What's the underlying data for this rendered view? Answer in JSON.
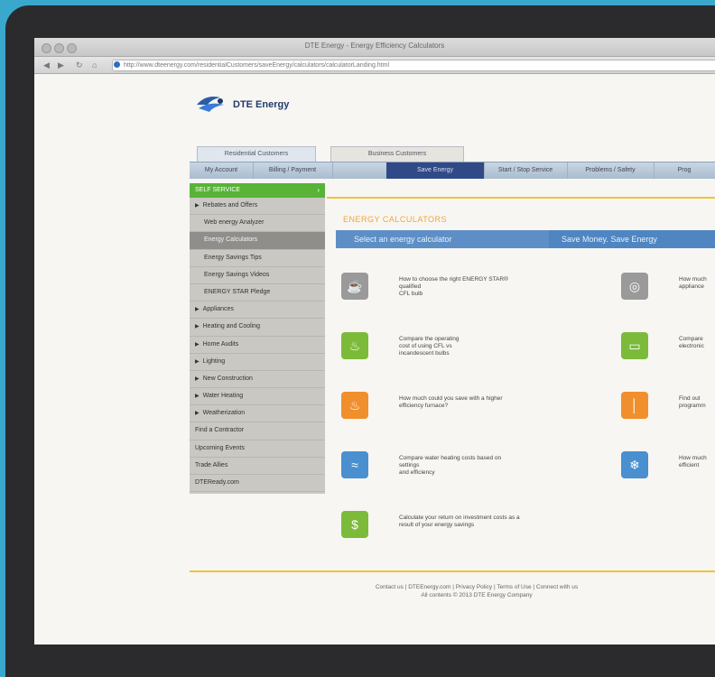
{
  "window": {
    "title": "DTE Energy - Energy Efficiency Calculators",
    "url": "http://www.dteenergy.com/residentialCustomers/saveEnergy/calculators/calculatorLanding.html"
  },
  "brand": {
    "name": "DTE Energy"
  },
  "customer_tabs": [
    "Residential Customers",
    "Business Customers"
  ],
  "nav": {
    "tabs": [
      "My Account",
      "Billing / Payment",
      "Save Energy",
      "Start / Stop Service",
      "Problems / Safety",
      "Prog"
    ],
    "active": "Save Energy"
  },
  "sidebar": {
    "header": "SELF SERVICE",
    "items": [
      {
        "label": "Rebates and Offers",
        "bullet": true,
        "sub": false
      },
      {
        "label": "Web energy Analyzer",
        "bullet": false,
        "sub": true
      },
      {
        "label": "Energy Calculators",
        "bullet": false,
        "sub": true,
        "selected": true
      },
      {
        "label": "Energy Savings Tips",
        "bullet": false,
        "sub": true
      },
      {
        "label": "Energy Savings Videos",
        "bullet": false,
        "sub": true
      },
      {
        "label": "ENERGY STAR Pledge",
        "bullet": false,
        "sub": true
      },
      {
        "label": "Appliances",
        "bullet": true,
        "sub": false
      },
      {
        "label": "Heating and Cooling",
        "bullet": true,
        "sub": false
      },
      {
        "label": "Home Audits",
        "bullet": true,
        "sub": false
      },
      {
        "label": "Lighting",
        "bullet": true,
        "sub": false
      },
      {
        "label": "New Construction",
        "bullet": true,
        "sub": false
      },
      {
        "label": "Water Heating",
        "bullet": true,
        "sub": false
      },
      {
        "label": "Weatherization",
        "bullet": true,
        "sub": false
      },
      {
        "label": "Find a Contractor",
        "bullet": false,
        "sub": false
      },
      {
        "label": "Upcoming Events",
        "bullet": false,
        "sub": false
      },
      {
        "label": "Trade Allies",
        "bullet": false,
        "sub": false
      },
      {
        "label": "DTEReady.com",
        "bullet": false,
        "sub": false
      }
    ]
  },
  "main": {
    "section_title": "ENERGY CALCULATORS",
    "banner_left": "Select an energy calculator",
    "banner_right": "Save Money. Save Energy",
    "calculators_left": [
      {
        "icon": "lamp-icon",
        "color": "#9a9a9a",
        "glyph": "☕",
        "text": [
          "How to choose the right ENERGY STAR®",
          "qualified",
          "CFL bulb"
        ]
      },
      {
        "icon": "bulb-icon",
        "color": "#7cbb3a",
        "glyph": "♨",
        "text": [
          "Compare the operating",
          "cost of using CFL vs",
          "incandescent bulbs"
        ]
      },
      {
        "icon": "flame-icon",
        "color": "#f08f2c",
        "glyph": "♨",
        "text": [
          "How much could you save with a higher",
          "efficiency furnace?"
        ]
      },
      {
        "icon": "water-drop-icon",
        "color": "#4a8fd0",
        "glyph": "≈",
        "text": [
          "Compare water heating costs based on",
          "settings",
          "and efficiency"
        ]
      },
      {
        "icon": "money-icon",
        "color": "#7cbb3a",
        "glyph": "$",
        "text": [
          "Calculate your return on investment costs as a",
          "result of your energy savings"
        ]
      }
    ],
    "calculators_right": [
      {
        "icon": "washer-icon",
        "color": "#9a9a9a",
        "glyph": "◎",
        "text": [
          "How much",
          "appliance"
        ]
      },
      {
        "icon": "monitor-icon",
        "color": "#7cbb3a",
        "glyph": "▭",
        "text": [
          "Compare",
          "electronic"
        ]
      },
      {
        "icon": "thermometer-icon",
        "color": "#f08f2c",
        "glyph": "│",
        "text": [
          "Find out",
          "programm"
        ]
      },
      {
        "icon": "snowflake-icon",
        "color": "#4a8fd0",
        "glyph": "❄",
        "text": [
          "How much",
          "efficient"
        ]
      }
    ]
  },
  "footer": {
    "line1": "Contact us | DTEEnergy.com | Privacy Policy | Terms of Use | Connect with us",
    "line2": "All contents © 2013 DTE Energy Company"
  }
}
